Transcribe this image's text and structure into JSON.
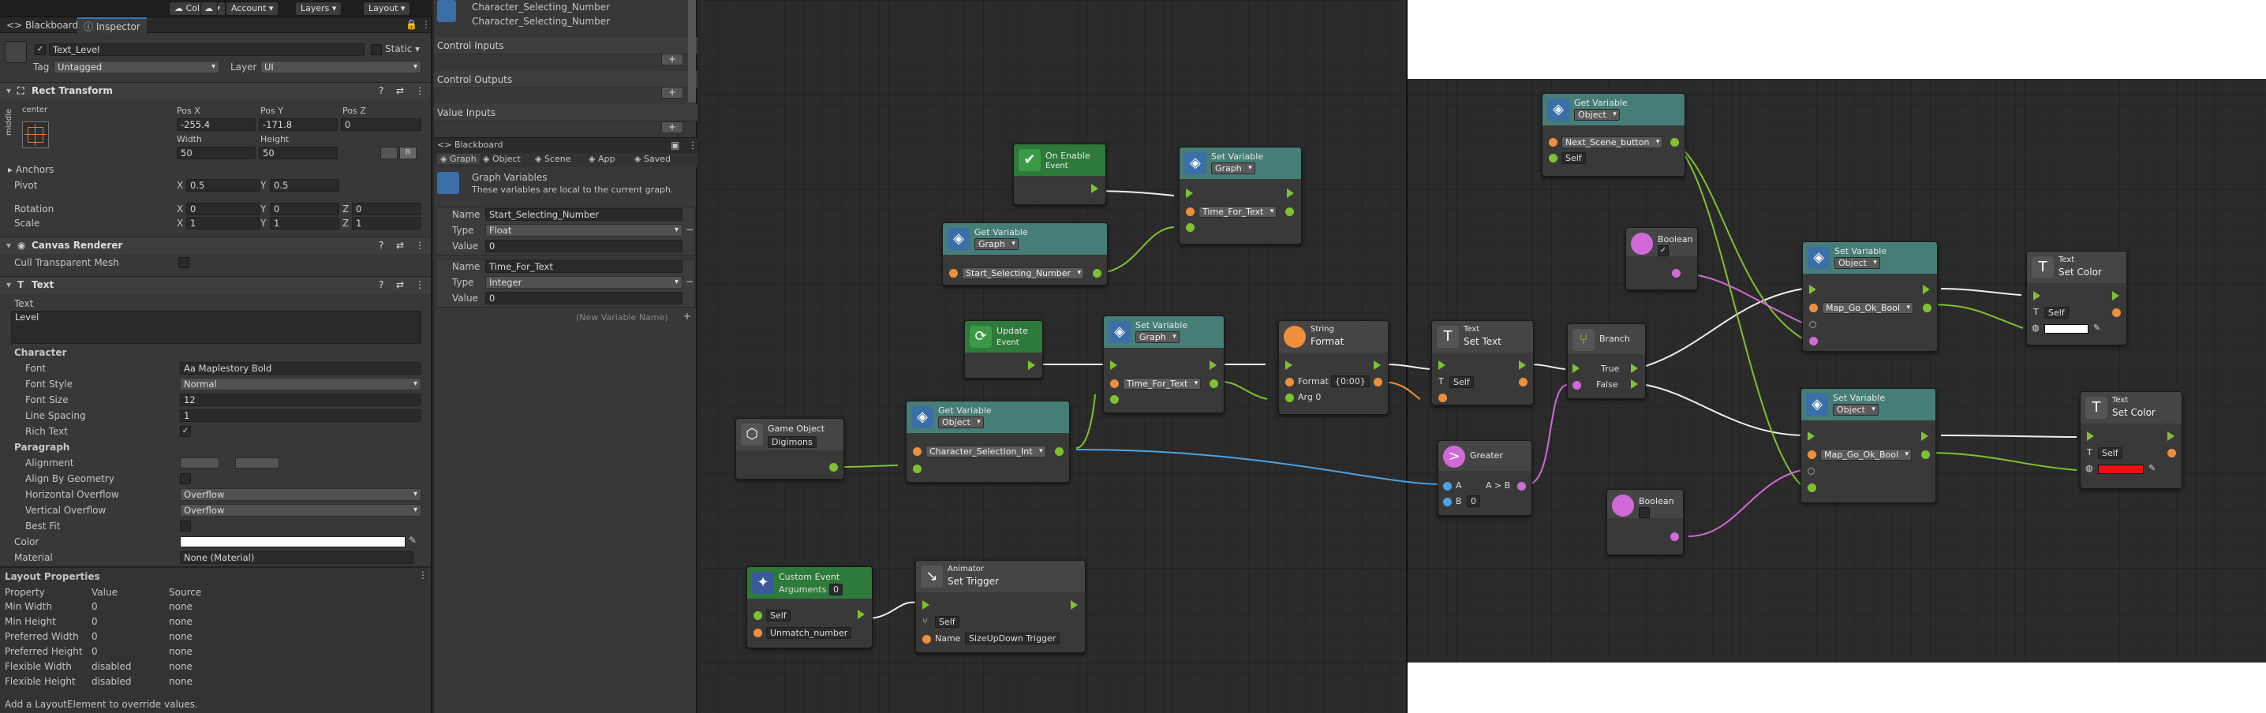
{
  "toolbar": {
    "collab": "Collab",
    "account": "Account",
    "layers": "Layers",
    "layout": "Layout"
  },
  "inspector": {
    "tabs": [
      "Blackboard",
      "Inspector"
    ],
    "object_name": "Text_Level",
    "static_label": "Static",
    "tag_label": "Tag",
    "tag_value": "Untagged",
    "layer_label": "Layer",
    "layer_value": "UI",
    "rect_transform": {
      "title": "Rect Transform",
      "anchor_h": "center",
      "anchor_v": "middle",
      "pos_x_label": "Pos X",
      "pos_y_label": "Pos Y",
      "pos_z_label": "Pos Z",
      "pos_x": "-255.4",
      "pos_y": "-171.8",
      "pos_z": "0",
      "width_label": "Width",
      "height_label": "Height",
      "width": "50",
      "height": "50",
      "r_label": "R",
      "anchors_label": "Anchors",
      "pivot_label": "Pivot",
      "pivot_x": "0.5",
      "pivot_y": "0.5",
      "rotation_label": "Rotation",
      "rot_x": "0",
      "rot_y": "0",
      "rot_z": "0",
      "scale_label": "Scale",
      "scale_x": "1",
      "scale_y": "1",
      "scale_z": "1",
      "x": "X",
      "y": "Y",
      "z": "Z"
    },
    "canvas_renderer": {
      "title": "Canvas Renderer",
      "cull_label": "Cull Transparent Mesh"
    },
    "text_comp": {
      "title": "Text",
      "text_label": "Text",
      "text_value": "Level",
      "character_label": "Character",
      "font_label": "Font",
      "font_value": "Maplestory Bold",
      "font_style_label": "Font Style",
      "font_style_value": "Normal",
      "font_size_label": "Font Size",
      "font_size_value": "12",
      "line_spacing_label": "Line Spacing",
      "line_spacing_value": "1",
      "rich_text_label": "Rich Text",
      "paragraph_label": "Paragraph",
      "alignment_label": "Alignment",
      "align_geo_label": "Align By Geometry",
      "h_overflow_label": "Horizontal Overflow",
      "h_overflow_value": "Overflow",
      "v_overflow_label": "Vertical Overflow",
      "v_overflow_value": "Overflow",
      "best_fit_label": "Best Fit",
      "color_label": "Color",
      "material_label": "Material",
      "material_value": "None (Material)"
    },
    "layout_props": {
      "title": "Layout Properties",
      "headers": [
        "Property",
        "Value",
        "Source"
      ],
      "rows": [
        [
          "Min Width",
          "0",
          "none"
        ],
        [
          "Min Height",
          "0",
          "none"
        ],
        [
          "Preferred Width",
          "0",
          "none"
        ],
        [
          "Preferred Height",
          "0",
          "none"
        ],
        [
          "Flexible Width",
          "disabled",
          "none"
        ],
        [
          "Flexible Height",
          "disabled",
          "none"
        ]
      ],
      "hint": "Add a LayoutElement to override values."
    }
  },
  "graph_panel": {
    "graph_name": "Character_Selecting_Number",
    "graph_subtitle": "Character_Selecting_Number",
    "control_inputs": "Control Inputs",
    "control_outputs": "Control Outputs",
    "value_inputs": "Value Inputs",
    "blackboard_tab": "Blackboard",
    "scope_tabs": [
      "Graph",
      "Object",
      "Scene",
      "App",
      "Saved"
    ],
    "graph_vars_title": "Graph Variables",
    "graph_vars_desc": "These variables are local to the current graph.",
    "name_label": "Name",
    "type_label": "Type",
    "value_label": "Value",
    "variables": [
      {
        "name": "Start_Selecting_Number",
        "type": "Float",
        "value": "0"
      },
      {
        "name": "Time_For_Text",
        "type": "Integer",
        "value": "0"
      }
    ],
    "new_var_placeholder": "(New Variable Name)"
  },
  "nodes": {
    "on_enable": {
      "title": "On Enable",
      "sub": "Event"
    },
    "set_var_1": {
      "title": "Set Variable",
      "scope": "Graph",
      "var": "Time_For_Text"
    },
    "get_var_1": {
      "title": "Get Variable",
      "scope": "Graph",
      "var": "Start_Selecting_Number"
    },
    "update": {
      "title": "Update",
      "sub": "Event"
    },
    "set_var_2": {
      "title": "Set Variable",
      "scope": "Graph",
      "var": "Time_For_Text"
    },
    "string_format": {
      "title": "Format",
      "cat": "String",
      "format_label": "Format",
      "format_value": "{0:00}",
      "arg_label": "Arg 0"
    },
    "game_object": {
      "title": "Game Object",
      "value": "Digimons"
    },
    "get_var_2": {
      "title": "Get Variable",
      "scope": "Object",
      "var": "Character_Selection_Int"
    },
    "custom_event": {
      "title": "Custom Event",
      "args_label": "Arguments",
      "args_value": "0",
      "self": "Self",
      "name": "Unmatch_number"
    },
    "animator": {
      "cat": "Animator",
      "title": "Set Trigger",
      "self": "Self",
      "name_label": "Name",
      "name_value": "SizeUpDown Trigger"
    },
    "set_text": {
      "cat": "Text",
      "title": "Set Text",
      "self": "Self"
    },
    "get_var_3": {
      "title": "Get Variable",
      "scope": "Object",
      "var": "Next_Scene_button",
      "self": "Self"
    },
    "boolean_1": {
      "title": "Boolean",
      "checked": "✓"
    },
    "branch": {
      "title": "Branch",
      "true_label": "True",
      "false_label": "False"
    },
    "greater": {
      "title": "Greater",
      "a_label": "A",
      "b_label": "B",
      "b_value": "0",
      "out_label": "A > B"
    },
    "boolean_2": {
      "title": "Boolean"
    },
    "set_var_3": {
      "title": "Set Variable",
      "scope": "Object",
      "var": "Map_Go_Ok_Bool"
    },
    "set_var_4": {
      "title": "Set Variable",
      "scope": "Object",
      "var": "Map_Go_Ok_Bool"
    },
    "set_color_1": {
      "cat": "Text",
      "title": "Set Color",
      "self": "Self",
      "color": "#ffffff"
    },
    "set_color_2": {
      "cat": "Text",
      "title": "Set Color",
      "self": "Self",
      "color": "#ee1111"
    }
  }
}
